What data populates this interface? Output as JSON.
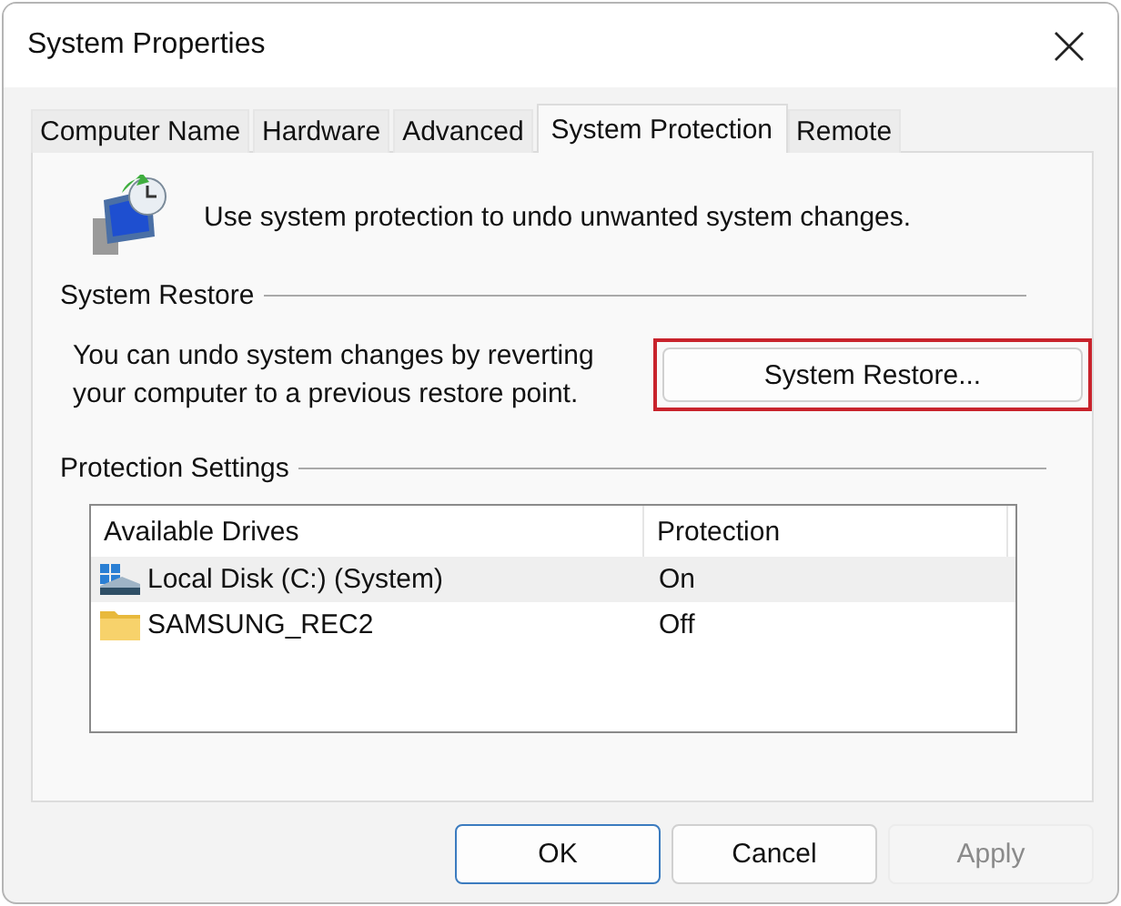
{
  "window": {
    "title": "System Properties"
  },
  "tabs": [
    {
      "label": "Computer Name",
      "selected": false
    },
    {
      "label": "Hardware",
      "selected": false
    },
    {
      "label": "Advanced",
      "selected": false
    },
    {
      "label": "System Protection",
      "selected": true
    },
    {
      "label": "Remote",
      "selected": false
    }
  ],
  "intro": "Use system protection to undo unwanted system changes.",
  "system_restore": {
    "heading": "System Restore",
    "description": "You can undo system changes by reverting your computer to a previous restore point.",
    "button": {
      "label": "System Restore...",
      "highlighted": true
    }
  },
  "protection_settings": {
    "heading": "Protection Settings",
    "table": {
      "columns": [
        "Available Drives",
        "Protection"
      ],
      "rows": [
        {
          "kind": "disk",
          "drive": "Local Disk (C:) (System)",
          "protection": "On",
          "selected": true
        },
        {
          "kind": "folder",
          "drive": "SAMSUNG_REC2",
          "protection": "Off",
          "selected": false
        }
      ]
    }
  },
  "buttons": [
    {
      "label": "OK",
      "default": true,
      "disabled": false
    },
    {
      "label": "Cancel",
      "default": false,
      "disabled": false
    },
    {
      "label": "Apply",
      "default": false,
      "disabled": true
    }
  ]
}
